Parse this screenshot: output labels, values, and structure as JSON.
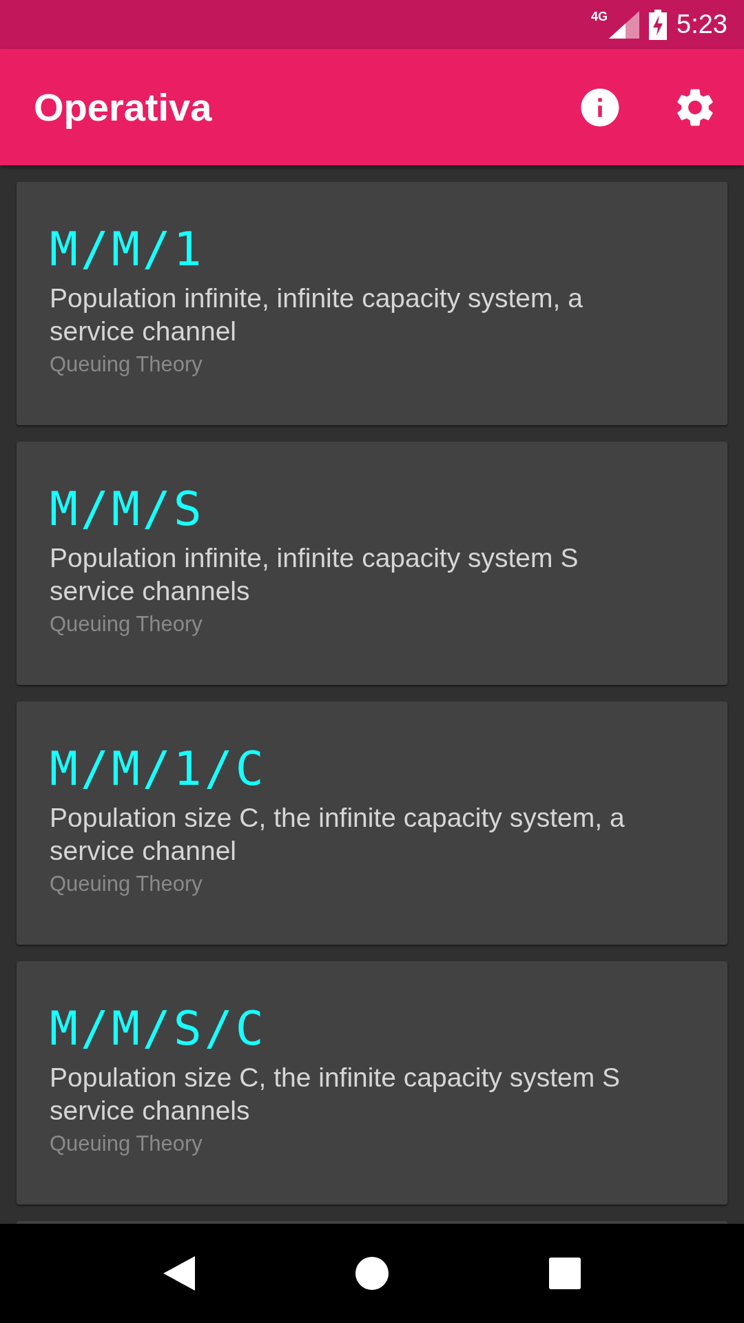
{
  "status_bar": {
    "network": "4G",
    "time": "5:23"
  },
  "app_bar": {
    "title": "Operativa"
  },
  "cards": [
    {
      "title": "M/M/1",
      "description": "Population infinite, infinite capacity system, a service channel",
      "category": "Queuing Theory"
    },
    {
      "title": "M/M/S",
      "description": "Population infinite, infinite capacity system S service channels",
      "category": "Queuing Theory"
    },
    {
      "title": "M/M/1/C",
      "description": "Population size C, the infinite capacity system, a service channel",
      "category": "Queuing Theory"
    },
    {
      "title": "M/M/S/C",
      "description": "Population size C, the infinite capacity system S service channels",
      "category": "Queuing Theory"
    }
  ]
}
